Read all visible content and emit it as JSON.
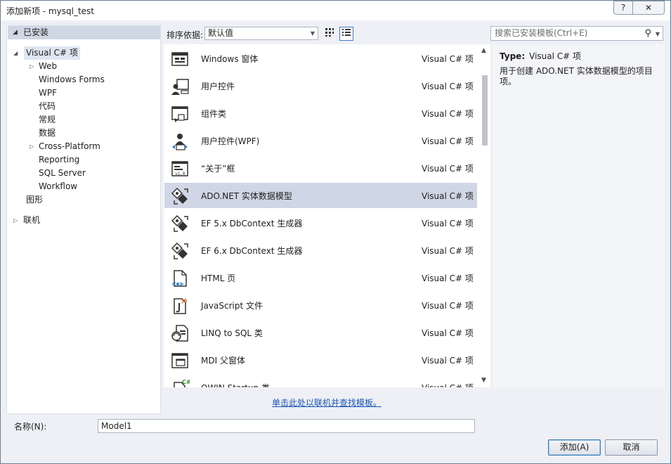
{
  "window": {
    "title": "添加新项 - mysql_test",
    "help_label": "?",
    "close_label": "✕"
  },
  "tree": {
    "category": "已安装",
    "root": "Visual C# 项",
    "children": [
      "Web",
      "Windows Forms",
      "WPF",
      "代码",
      "常规",
      "数据",
      "Cross-Platform",
      "Reporting",
      "SQL Server",
      "Workflow"
    ],
    "graphics": "图形",
    "online": "联机"
  },
  "toolbar": {
    "sort_label": "排序依据:",
    "sort_value": "默认值"
  },
  "search": {
    "placeholder": "搜索已安装模板(Ctrl+E)"
  },
  "templates": [
    {
      "name": "Windows 窗体",
      "type": "Visual C# 项",
      "icon": "form-icon"
    },
    {
      "name": "用户控件",
      "type": "Visual C# 项",
      "icon": "user-control-icon"
    },
    {
      "name": "组件类",
      "type": "Visual C# 项",
      "icon": "component-class-icon"
    },
    {
      "name": "用户控件(WPF)",
      "type": "Visual C# 项",
      "icon": "wpf-user-control-icon"
    },
    {
      "name": "“关于”框",
      "type": "Visual C# 项",
      "icon": "about-box-icon"
    },
    {
      "name": "ADO.NET 实体数据模型",
      "type": "Visual C# 项",
      "icon": "entity-model-icon"
    },
    {
      "name": "EF 5.x DbContext 生成器",
      "type": "Visual C# 项",
      "icon": "entity-model-icon"
    },
    {
      "name": "EF 6.x DbContext 生成器",
      "type": "Visual C# 项",
      "icon": "entity-model-icon"
    },
    {
      "name": "HTML 页",
      "type": "Visual C# 项",
      "icon": "html-page-icon"
    },
    {
      "name": "JavaScript 文件",
      "type": "Visual C# 项",
      "icon": "javascript-file-icon"
    },
    {
      "name": "LINQ to SQL 类",
      "type": "Visual C# 项",
      "icon": "linq-to-sql-icon"
    },
    {
      "name": "MDI 父窗体",
      "type": "Visual C# 项",
      "icon": "mdi-form-icon"
    },
    {
      "name": "OWIN Startup 类",
      "type": "Visual C# 项",
      "icon": "csharp-class-icon"
    }
  ],
  "selected_index": 5,
  "description": {
    "type_label": "Type:",
    "type_value": "Visual C# 项",
    "text": "用于创建 ADO.NET 实体数据模型的项目项。"
  },
  "online_link": "单击此处以联机并查找模板。",
  "bottom": {
    "name_label": "名称(N):",
    "name_value": "Model1",
    "add_label": "添加(A)",
    "cancel_label": "取消"
  }
}
